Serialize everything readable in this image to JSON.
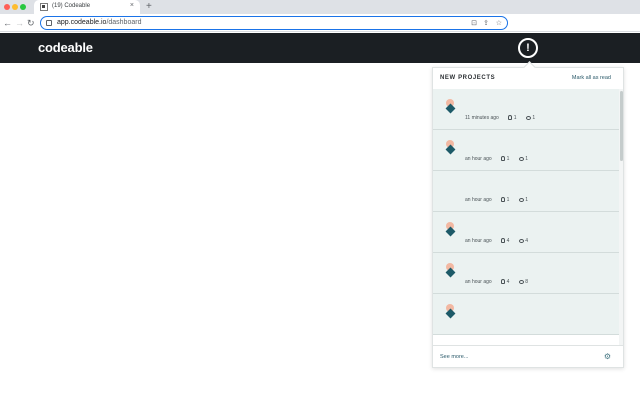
{
  "browser": {
    "tab_title": "(19) Codeable",
    "tab_close": "×",
    "new_tab": "+",
    "url_host": "app.codeable.io",
    "url_path": "/dashboard",
    "nav": {
      "back": "←",
      "forward": "→",
      "reload": "↻"
    },
    "omnibox_icons": {
      "install": "⊡",
      "share": "⇪",
      "bookmark": "☆"
    }
  },
  "header": {
    "logo": "codeable",
    "alert_glyph": "!"
  },
  "notifications": {
    "title": "NEW PROJECTS",
    "mark_all_read": "Mark all as read",
    "items": [
      {
        "has_avatar": true,
        "time": "11 minutes ago",
        "users": "1",
        "comments": "1"
      },
      {
        "has_avatar": true,
        "time": "an hour ago",
        "users": "1",
        "comments": "1"
      },
      {
        "has_avatar": false,
        "time": "an hour ago",
        "users": "1",
        "comments": "1"
      },
      {
        "has_avatar": true,
        "time": "an hour ago",
        "users": "4",
        "comments": "4"
      },
      {
        "has_avatar": true,
        "time": "an hour ago",
        "users": "4",
        "comments": "8"
      },
      {
        "has_avatar": true,
        "time": "",
        "users": "",
        "comments": ""
      }
    ],
    "see_more": "See more...",
    "settings_glyph": "⚙"
  },
  "colors": {
    "header_bg": "#1b1f23",
    "item_bg": "#ebf2f1",
    "avatar_dot": "#f2b8a2",
    "avatar_diamond": "#1d5a68",
    "link": "#2b5a6a"
  }
}
